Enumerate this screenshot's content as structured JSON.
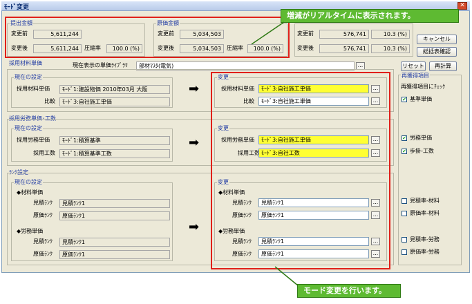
{
  "window": {
    "title": "ﾓｰﾄﾞ変更"
  },
  "submit": {
    "title": "提出金額",
    "before_label": "変更前",
    "before_value": "5,611,244",
    "after_label": "変更後",
    "after_value": "5,611,244",
    "rate_label": "圧縮率",
    "rate_value": "100.0 (%)"
  },
  "cost": {
    "title": "原価金額",
    "before_label": "変更前",
    "before_value": "5,034,503",
    "after_label": "変更後",
    "after_value": "5,034,503",
    "rate_label": "圧縮率",
    "rate_value": "100.0 (%)"
  },
  "diff": {
    "before_value": "576,741",
    "before_rate": "10.3 (%)",
    "after_value": "576,741",
    "after_rate": "10.3 (%)"
  },
  "buttons": {
    "cancel": "キャンセル",
    "total": "総括表確認",
    "reset": "リセット",
    "recalc": "再計算",
    "dots": "..."
  },
  "unit": {
    "section": "採用材料単価",
    "current_lib_label": "現在表示の単価ﾗｲﾌﾞﾗﾘ",
    "current_lib_value": "部材ﾏｽﾀ(電気)",
    "cur_title": "現在の設定",
    "new_title": "変更",
    "mat_label": "採用材料単価",
    "mat_cur": "ﾓｰﾄﾞ1:建設物価 2010年03月 大阪",
    "mat_new": "ﾓｰﾄﾞ3:自社施工単価",
    "cmp_label": "比較",
    "cmp_cur": "ﾓｰﾄﾞ3:自社施工単価",
    "cmp_new": "ﾓｰﾄﾞ3:自社施工単価"
  },
  "labor": {
    "section": "採用労務単価･工数",
    "cur_title": "現在の設定",
    "new_title": "変更",
    "lab_label": "採用労務単価",
    "lab_cur": "ﾓｰﾄﾞ1:積算基準",
    "lab_new": "ﾓｰﾄﾞ3:自社施工単価",
    "man_label": "採用工数",
    "man_cur": "ﾓｰﾄﾞ1:積算基準工数",
    "man_new": "ﾓｰﾄﾞ3:自社工数"
  },
  "rank": {
    "section": "ﾗﾝｸ設定",
    "cur_title": "現在の設定",
    "new_title": "変更",
    "mat_head": "◆材料単価",
    "lab_head": "◆労務単価",
    "est_label": "見積ﾗﾝｸ",
    "cost_label": "原価ﾗﾝｸ",
    "mat_est_cur": "見積ﾗﾝｸ1",
    "mat_cost_cur": "原価ﾗﾝｸ1",
    "lab_est_cur": "見積ﾗﾝｸ1",
    "lab_cost_cur": "原価ﾗﾝｸ1",
    "mat_est_new": "見積ﾗﾝｸ1",
    "mat_cost_new": "原価ﾗﾝｸ1",
    "lab_est_new": "見積ﾗﾝｸ1",
    "lab_cost_new": "原価ﾗﾝｸ1"
  },
  "reacq": {
    "title": "再獲得項目",
    "subtitle": "再獲得項目にﾁｪｯｸ",
    "items": [
      {
        "label": "基準単価",
        "checked": true
      },
      {
        "label": "労務単価",
        "checked": true
      },
      {
        "label": "歩掛-工数",
        "checked": true
      },
      {
        "label": "見積率-材料",
        "checked": false
      },
      {
        "label": "原価率-材料",
        "checked": false
      },
      {
        "label": "見積率-労務",
        "checked": false
      },
      {
        "label": "原価率-労務",
        "checked": false
      }
    ]
  },
  "callouts": {
    "top": "増減がリアルタイムに表示されます。",
    "bottom": "モード変更を行います。"
  },
  "colors": {
    "highlight_red": "#e0201a",
    "callout_green": "#5eba32",
    "field_yellow": "#ffff33"
  }
}
